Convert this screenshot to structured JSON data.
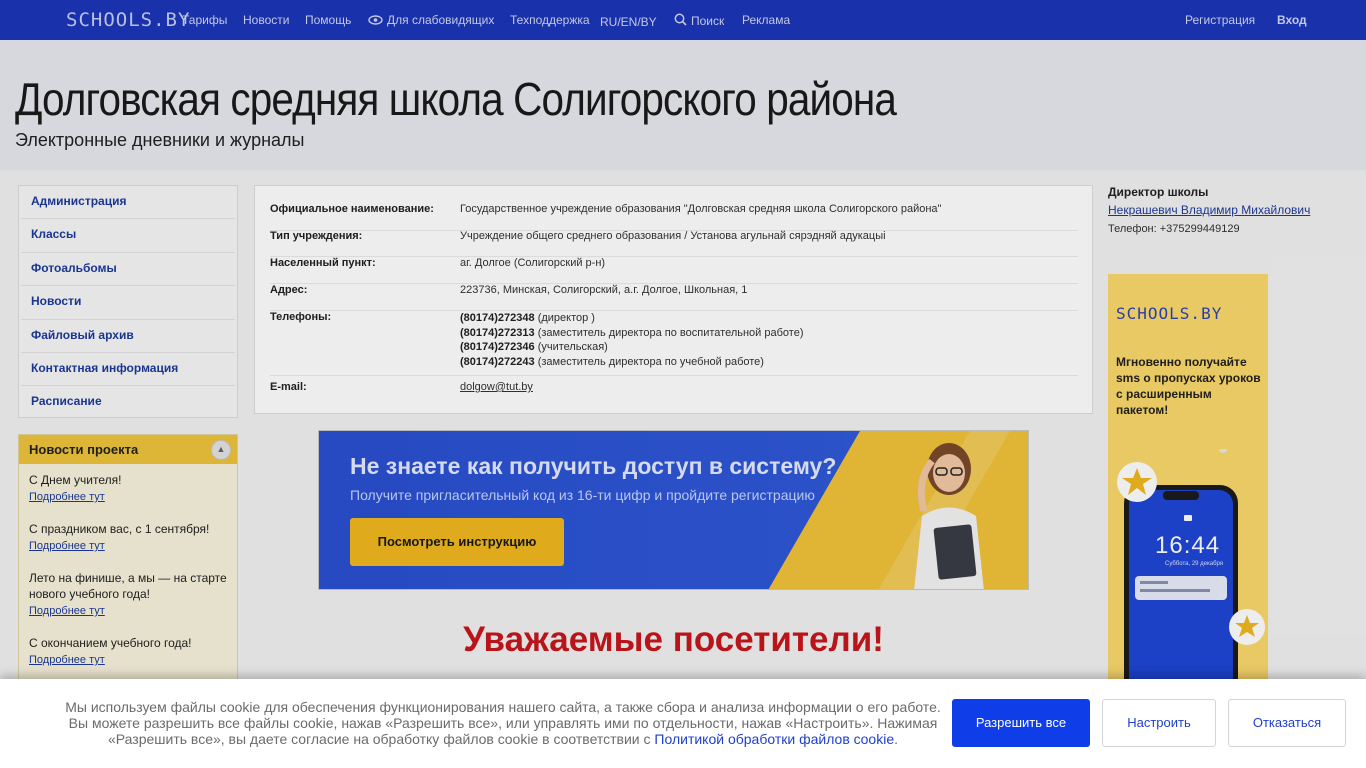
{
  "topbar": {
    "logo": "SCHOOLS.BY",
    "nav": [
      "Тарифы",
      "Новости",
      "Помощь",
      "Для слабовидящих",
      "Техподдержка",
      "RU/EN/BY",
      "Поиск",
      "Реклама"
    ],
    "register": "Регистрация",
    "login": "Вход",
    "colors": {
      "bar": "#1b35b7"
    }
  },
  "header": {
    "title": "Долговская средняя школа Солигорского района",
    "subtitle": "Электронные дневники и журналы"
  },
  "sidebar": {
    "menu": [
      "Администрация",
      "Классы",
      "Фотоальбомы",
      "Новости",
      "Файловый архив",
      "Контактная информация",
      "Расписание"
    ]
  },
  "news": {
    "title": "Новости проекта",
    "items": [
      {
        "title": "С Днем учителя!",
        "more": "Подробнее тут"
      },
      {
        "title": "С праздником вас, с 1 сентября!",
        "more": "Подробнее тут"
      },
      {
        "title": "Лето на финише, а мы — на старте нового учебного года!",
        "more": "Подробнее тут"
      },
      {
        "title": "С окончанием учебного года!",
        "more": "Подробнее тут"
      }
    ]
  },
  "info": {
    "official_name_label": "Официальное наименование:",
    "official_name": "Государственное учреждение образования \"Долговская средняя школа Солигорского района\"",
    "type_label": "Тип учреждения:",
    "type": "Учреждение общего среднего образования / Установа агульнай сярэдняй адукацыі",
    "locality_label": "Населенный пункт:",
    "locality": "аг. Долгое (Солигорский р-н)",
    "address_label": "Адрес:",
    "address": "223736, Минская, Солигорский, а.г. Долгое, Школьная, 1",
    "phones_label": "Телефоны:",
    "phones": [
      {
        "number": "(80174)272348",
        "note": "(директор )"
      },
      {
        "number": "(80174)272313",
        "note": "(заместитель директора по воспитательной работе)"
      },
      {
        "number": "(80174)272346",
        "note": "(учительская)"
      },
      {
        "number": "(80174)272243",
        "note": "(заместитель директора по учебной работе)"
      }
    ],
    "email_label": "E-mail:",
    "email": "dolgow@tut.by"
  },
  "banner": {
    "heading": "Не знаете как получить доступ в систему?",
    "sub": "Получите пригласительный код из 16-ти цифр и пройдите регистрацию",
    "button": "Посмотреть инструкцию"
  },
  "visitors_heading": "Уважаемые посетители!",
  "director": {
    "label": "Директор школы",
    "name": "Некрашевич Владимир Михайлович",
    "phone": "Телефон: +375299449129"
  },
  "ad": {
    "logo": "SCHOOLS.BY",
    "text": "Мгновенно получайте sms о пропусках уроков с расширенным пакетом!",
    "phone_time": "16:44",
    "phone_date": "Суббота, 29 декабря"
  },
  "cookie": {
    "text": "Мы используем файлы cookie для обеспечения функционирования нашего сайта, а также сбора и анализа информации о его работе. Вы можете разрешить все файлы cookie, нажав «Разрешить все», или управлять ими по отдельности, нажав «Настроить». Нажимая «Разрешить все», вы даете согласие на обработку файлов cookie в соответствии с",
    "link": "Политикой обработки файлов cookie",
    "end": ".",
    "allow": "Разрешить все",
    "configure": "Настроить",
    "reject": "Отказаться"
  }
}
